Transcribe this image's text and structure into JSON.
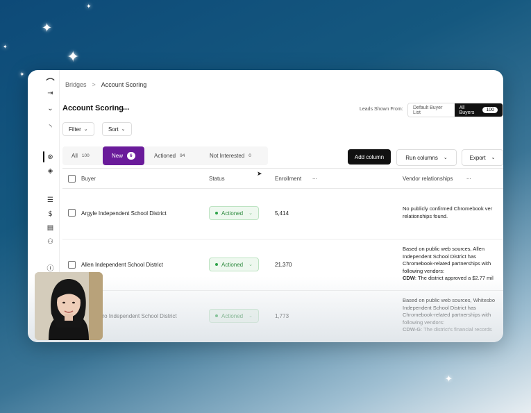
{
  "breadcrumb": {
    "parent": "Bridges",
    "separator": ">",
    "current": "Account Scoring"
  },
  "page": {
    "title": "Account Scoring",
    "more": "..."
  },
  "leads": {
    "label": "Leads Shown From:",
    "options": [
      {
        "label": "Default Buyer List"
      },
      {
        "label": "All Buyers",
        "count": "100",
        "active": true
      }
    ]
  },
  "filters": {
    "filter_label": "Filter",
    "sort_label": "Sort"
  },
  "tabs": [
    {
      "label": "All",
      "count": "100"
    },
    {
      "label": "New",
      "count": "6",
      "active": true
    },
    {
      "label": "Actioned",
      "count": "94"
    },
    {
      "label": "Not Interested",
      "count": "0"
    }
  ],
  "actions": {
    "add_column": "Add column",
    "run_columns": "Run columns",
    "export": "Export"
  },
  "table": {
    "headers": {
      "buyer": "Buyer",
      "status": "Status",
      "enrollment": "Enrollment",
      "vendor": "Vendor relationships",
      "more": "..."
    },
    "rows": [
      {
        "buyer": "Argyle Independent School District",
        "status": "Actioned",
        "enrollment": "5,414",
        "vendor": [
          "No publicly confirmed Chromebook ver",
          "relationships found."
        ]
      },
      {
        "buyer": "Allen Independent School District",
        "status": "Actioned",
        "enrollment": "21,370",
        "vendor": [
          "Based on public web sources, Allen",
          "Independent School District has",
          "Chromebook-related partnerships with",
          "following vendors:"
        ],
        "vendor_bold": "CDW",
        "vendor_rest": ": The district approved a $2.77 mil"
      },
      {
        "buyer": "oro Independent School District",
        "status": "Actioned",
        "enrollment": "1,773",
        "vendor": [
          "Based on public web sources, Whitesbo",
          "Independent School District has",
          "Chromebook-related partnerships with",
          "following vendors:"
        ],
        "vendor_bold": "CDW-G",
        "vendor_rest": ": The district's financial records"
      }
    ]
  },
  "icons": [
    "logo-icon",
    "collapse-icon",
    "chevron-down-icon",
    "rss-icon",
    "bridges-icon",
    "tag-icon",
    "list-icon",
    "dollar-icon",
    "document-icon",
    "users-icon",
    "help-icon"
  ]
}
